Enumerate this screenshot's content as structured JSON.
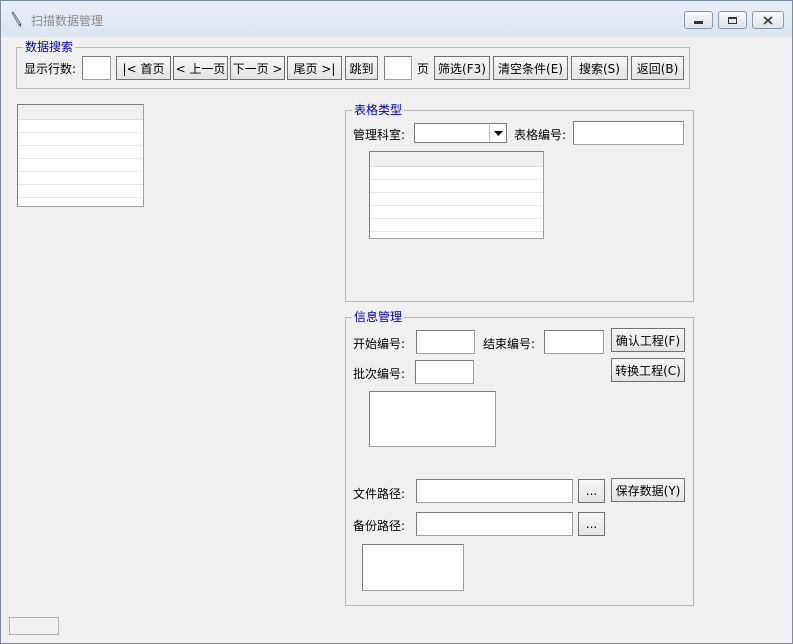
{
  "window": {
    "title": "扫描数据管理",
    "icons": {
      "app": "pen-icon",
      "minimize": "minimize-icon",
      "maximize": "maximize-icon",
      "close": "close-icon"
    }
  },
  "search_group": {
    "legend": "数据搜索",
    "rows_label": "显示行数:",
    "rows_value": "",
    "first_page": "|< 首页",
    "prev_page": "< 上一页",
    "next_page": "下一页 >",
    "last_page": "尾页 >|",
    "jump": "跳到",
    "page_value": "",
    "page_unit": "页",
    "filter": "筛选(F3)",
    "clear": "清空条件(E)",
    "search": "搜索(S)",
    "back": "返回(B)"
  },
  "form_type_group": {
    "legend": "表格类型",
    "dept_label": "管理科室:",
    "dept_value": "",
    "form_no_label": "表格编号:",
    "form_no_value": ""
  },
  "info_group": {
    "legend": "信息管理",
    "start_label": "开始编号:",
    "start_value": "",
    "end_label": "结束编号:",
    "end_value": "",
    "confirm_btn": "确认工程(F)",
    "batch_label": "批次编号:",
    "batch_value": "",
    "convert_btn": "转换工程(C)",
    "file_path_label": "文件路径:",
    "file_path_value": "",
    "browse_label": "...",
    "save_btn": "保存数据(Y)",
    "backup_path_label": "备份路径:",
    "backup_path_value": "",
    "browse2_label": "..."
  }
}
